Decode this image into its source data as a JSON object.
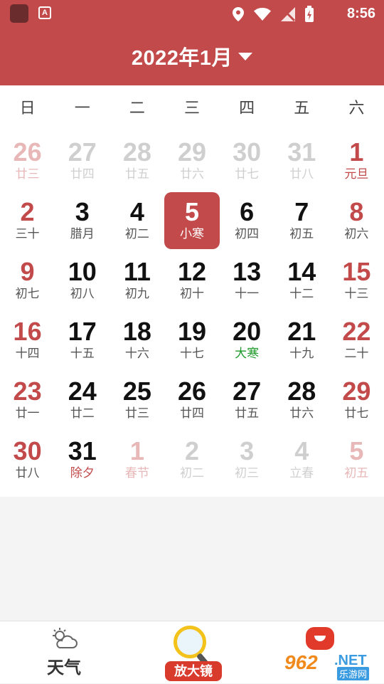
{
  "status_bar": {
    "time": "8:56",
    "app_badge": "A"
  },
  "header": {
    "title": "2022年1月"
  },
  "weekdays": [
    "日",
    "一",
    "二",
    "三",
    "四",
    "五",
    "六"
  ],
  "colors": {
    "red": "#c24a4a",
    "red_faded": "#e8b7b7",
    "black": "#111111",
    "gray_faded": "#cfcfcf",
    "lunar_gray": "#555555",
    "lunar_faded": "#cfcfcf",
    "green": "#1f9a2c"
  },
  "calendar": {
    "today_index": 10,
    "days": [
      {
        "num": "26",
        "lunar": "廿三",
        "style": "faded-red"
      },
      {
        "num": "27",
        "lunar": "廿四",
        "style": "faded"
      },
      {
        "num": "28",
        "lunar": "廿五",
        "style": "faded"
      },
      {
        "num": "29",
        "lunar": "廿六",
        "style": "faded"
      },
      {
        "num": "30",
        "lunar": "廿七",
        "style": "faded"
      },
      {
        "num": "31",
        "lunar": "廿八",
        "style": "faded"
      },
      {
        "num": "1",
        "lunar": "元旦",
        "style": "red",
        "lunar_style": "red"
      },
      {
        "num": "2",
        "lunar": "三十",
        "style": "red"
      },
      {
        "num": "3",
        "lunar": "腊月",
        "style": "normal"
      },
      {
        "num": "4",
        "lunar": "初二",
        "style": "normal"
      },
      {
        "num": "5",
        "lunar": "小寒",
        "style": "today"
      },
      {
        "num": "6",
        "lunar": "初四",
        "style": "normal"
      },
      {
        "num": "7",
        "lunar": "初五",
        "style": "normal"
      },
      {
        "num": "8",
        "lunar": "初六",
        "style": "red"
      },
      {
        "num": "9",
        "lunar": "初七",
        "style": "red"
      },
      {
        "num": "10",
        "lunar": "初八",
        "style": "normal"
      },
      {
        "num": "11",
        "lunar": "初九",
        "style": "normal"
      },
      {
        "num": "12",
        "lunar": "初十",
        "style": "normal"
      },
      {
        "num": "13",
        "lunar": "十一",
        "style": "normal"
      },
      {
        "num": "14",
        "lunar": "十二",
        "style": "normal"
      },
      {
        "num": "15",
        "lunar": "十三",
        "style": "red"
      },
      {
        "num": "16",
        "lunar": "十四",
        "style": "red"
      },
      {
        "num": "17",
        "lunar": "十五",
        "style": "normal"
      },
      {
        "num": "18",
        "lunar": "十六",
        "style": "normal"
      },
      {
        "num": "19",
        "lunar": "十七",
        "style": "normal"
      },
      {
        "num": "20",
        "lunar": "大寒",
        "style": "normal",
        "lunar_style": "green"
      },
      {
        "num": "21",
        "lunar": "十九",
        "style": "normal"
      },
      {
        "num": "22",
        "lunar": "二十",
        "style": "red"
      },
      {
        "num": "23",
        "lunar": "廿一",
        "style": "red"
      },
      {
        "num": "24",
        "lunar": "廿二",
        "style": "normal"
      },
      {
        "num": "25",
        "lunar": "廿三",
        "style": "normal"
      },
      {
        "num": "26",
        "lunar": "廿四",
        "style": "normal"
      },
      {
        "num": "27",
        "lunar": "廿五",
        "style": "normal"
      },
      {
        "num": "28",
        "lunar": "廿六",
        "style": "normal"
      },
      {
        "num": "29",
        "lunar": "廿七",
        "style": "red"
      },
      {
        "num": "30",
        "lunar": "廿八",
        "style": "red"
      },
      {
        "num": "31",
        "lunar": "除夕",
        "style": "normal",
        "lunar_style": "red"
      },
      {
        "num": "1",
        "lunar": "春节",
        "style": "faded-red",
        "lunar_style": "faded-red"
      },
      {
        "num": "2",
        "lunar": "初二",
        "style": "faded"
      },
      {
        "num": "3",
        "lunar": "初三",
        "style": "faded"
      },
      {
        "num": "4",
        "lunar": "立春",
        "style": "faded"
      },
      {
        "num": "5",
        "lunar": "初五",
        "style": "faded-red"
      }
    ]
  },
  "bottom_nav": {
    "weather_label": "天气",
    "magnifier_label": "放大镜",
    "watermark_logo": "962",
    "watermark_net": ".NET",
    "watermark_cn": "乐游网"
  }
}
